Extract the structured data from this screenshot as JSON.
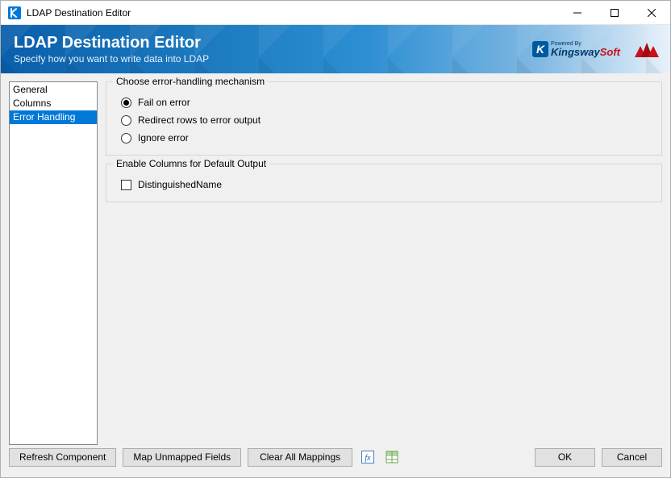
{
  "titlebar": {
    "title": "LDAP Destination Editor"
  },
  "banner": {
    "heading": "LDAP Destination Editor",
    "subheading": "Specify how you want to write data into LDAP",
    "powered_by": "Powered By",
    "brand_a": "Kingsway",
    "brand_b": "Soft"
  },
  "sidebar": {
    "items": [
      {
        "label": "General",
        "selected": false
      },
      {
        "label": "Columns",
        "selected": false
      },
      {
        "label": "Error Handling",
        "selected": true
      }
    ]
  },
  "error_group": {
    "legend": "Choose error-handling mechanism",
    "options": [
      {
        "label": "Fail on error",
        "checked": true
      },
      {
        "label": "Redirect rows to error output",
        "checked": false
      },
      {
        "label": "Ignore error",
        "checked": false
      }
    ]
  },
  "columns_group": {
    "legend": "Enable Columns for Default Output",
    "items": [
      {
        "label": "DistinguishedName",
        "checked": false
      }
    ]
  },
  "buttons": {
    "refresh": "Refresh Component",
    "map_unmapped": "Map Unmapped Fields",
    "clear_mappings": "Clear All Mappings",
    "ok": "OK",
    "cancel": "Cancel"
  }
}
